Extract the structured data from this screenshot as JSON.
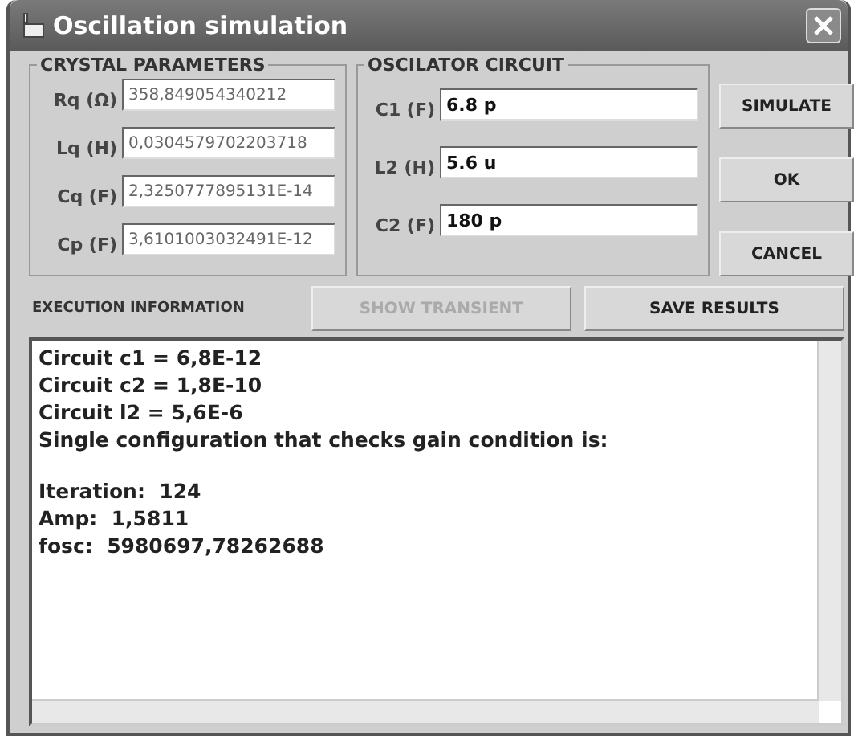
{
  "window": {
    "title": "Oscillation simulation"
  },
  "crystal": {
    "title": "CRYSTAL PARAMETERS",
    "fields": [
      {
        "label": "Rq (Ω)",
        "value": "358,849054340212"
      },
      {
        "label": "Lq (H)",
        "value": "0,0304579702203718"
      },
      {
        "label": "Cq (F)",
        "value": "2,3250777895131E-14"
      },
      {
        "label": "Cp (F)",
        "value": "3,6101003032491E-12"
      }
    ]
  },
  "oscillator": {
    "title": "OSCILATOR CIRCUIT",
    "fields": [
      {
        "label": "C1 (F)",
        "value": "6.8 p"
      },
      {
        "label": "L2 (H)",
        "value": "5.6 u"
      },
      {
        "label": "C2 (F)",
        "value": "180 p"
      }
    ]
  },
  "side_buttons": [
    "SIMULATE",
    "OK",
    "CANCEL"
  ],
  "execution": {
    "label": "EXECUTION INFORMATION",
    "buttons": [
      {
        "label": "SHOW TRANSIENT",
        "disabled": true
      },
      {
        "label": "SAVE RESULTS",
        "disabled": false
      }
    ],
    "output_blocks": [
      [
        "Circuit c1 = 6,8E-12",
        "Circuit c2 = 1,8E-10",
        "Circuit l2 = 5,6E-6",
        "Single configuration that checks gain condition is:"
      ],
      [
        "Iteration:  124",
        "Amp:  1,5811",
        "fosc:  5980697,78262688"
      ]
    ]
  }
}
